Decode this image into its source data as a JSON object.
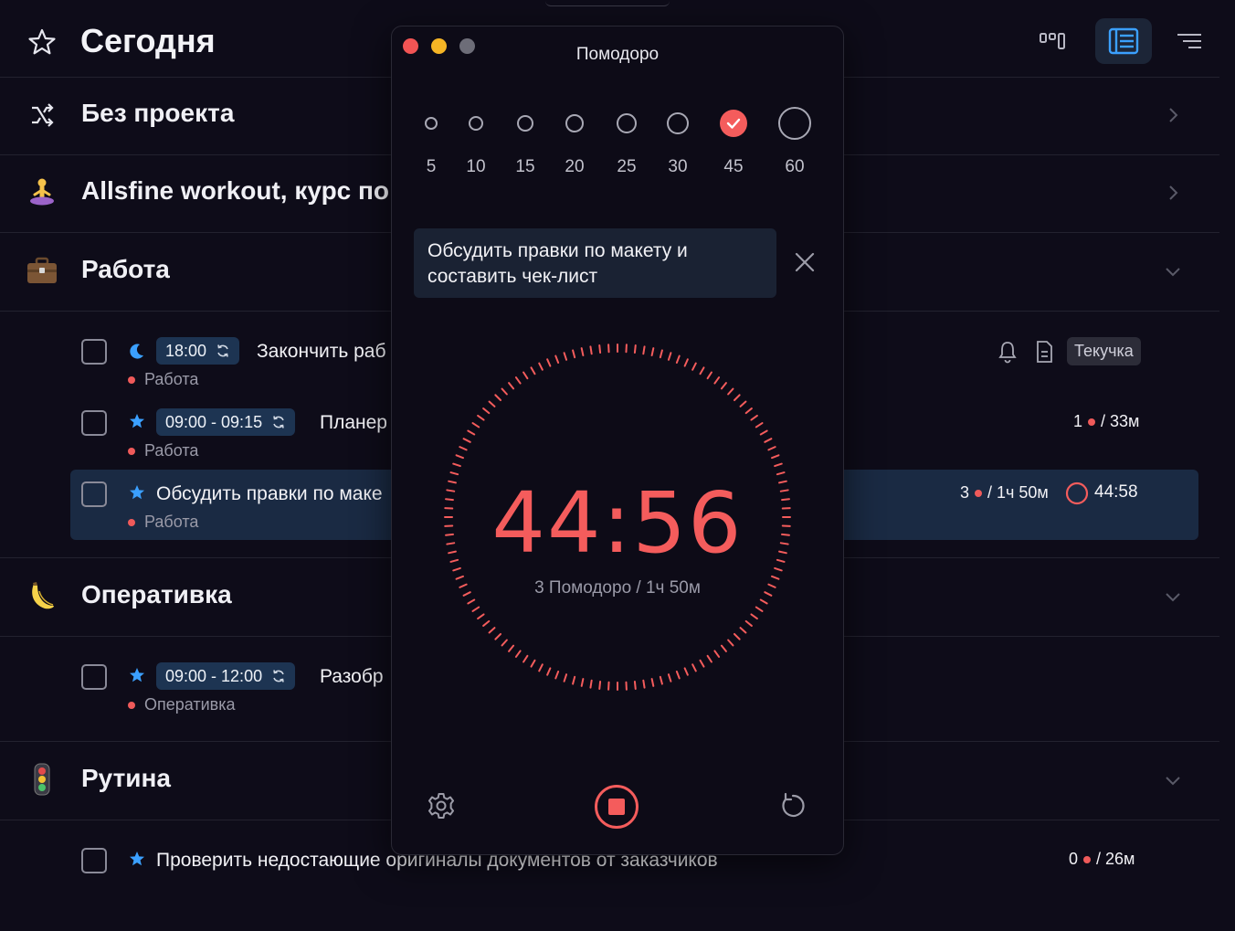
{
  "header": {
    "title": "Сегодня"
  },
  "projects": [
    {
      "name": "Без проекта",
      "icon": "shuffle-icon"
    },
    {
      "name": "Allsfine workout, курс по",
      "icon": "person-yoga-emoji"
    },
    {
      "name": "Работа",
      "icon": "briefcase-emoji"
    },
    {
      "name": "Оперативка",
      "icon": "banana-emoji"
    },
    {
      "name": "Рутина",
      "icon": "traffic-light-emoji"
    }
  ],
  "tasks": [
    {
      "time": "18:00",
      "title": "Закончить раб",
      "project": "Работа",
      "tag": "Текучка"
    },
    {
      "time": "09:00 - 09:15",
      "title": "Планер",
      "project": "Работа",
      "pomos": "1",
      "duration": "/ 33м"
    },
    {
      "title": "Обсудить правки по маке",
      "project": "Работа",
      "pomos": "3",
      "duration": "/ 1ч 50м",
      "timer": "44:58"
    },
    {
      "time": "09:00 - 12:00",
      "title": "Разобр",
      "project": "Оперативка"
    },
    {
      "title": "Проверить недостающие оригиналы документов от заказчиков",
      "pomos": "0",
      "duration": "/ 26м"
    }
  ],
  "pomodoro": {
    "window_title": "Помодоро",
    "durations": [
      "5",
      "10",
      "15",
      "20",
      "25",
      "30",
      "45",
      "60"
    ],
    "selected_duration": "45",
    "task": "Обсудить правки по макету и составить чек-лист",
    "time_left": "44:56",
    "summary": "3 Помодоро / 1ч 50м"
  },
  "colors": {
    "accent": "#f45c5c",
    "badge_bg": "#1d3452",
    "highlight_bg": "#1a2a43",
    "star": "#3ba0ff"
  }
}
